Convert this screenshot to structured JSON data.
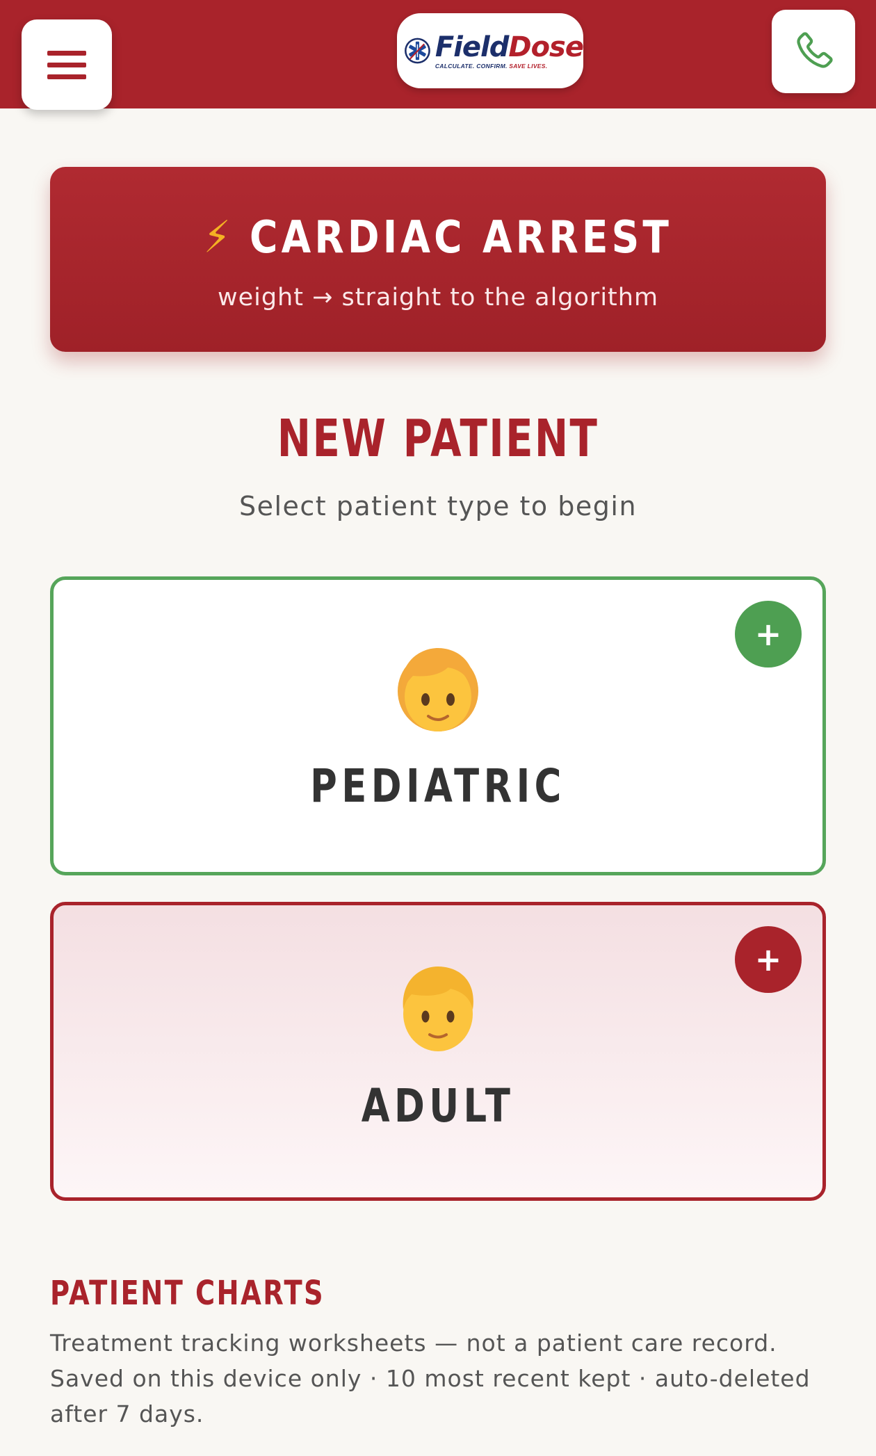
{
  "header": {
    "menu_icon": "hamburger-menu-icon",
    "phone_icon": "phone-icon",
    "logo": {
      "name_part1": "Field",
      "name_part2": "Dose",
      "tagline_part1": "CALCULATE. CONFIRM.",
      "tagline_part2": "SAVE LIVES."
    },
    "colors": {
      "bar": "#a9232b",
      "phone": "#4e9f52"
    }
  },
  "cardiac": {
    "icon": "lightning-bolt-icon",
    "title": "CARDIAC ARREST",
    "subtitle": "weight → straight to the algorithm"
  },
  "new_patient": {
    "title": "NEW PATIENT",
    "subtitle": "Select patient type to begin"
  },
  "cards": {
    "pediatric": {
      "label": "PEDIATRIC",
      "add_icon": "+",
      "accent": "#56a55a"
    },
    "adult": {
      "label": "ADULT",
      "add_icon": "+",
      "accent": "#a9232b"
    }
  },
  "patient_charts": {
    "title": "PATIENT CHARTS",
    "line1": "Treatment tracking worksheets — not a patient care record.",
    "line2": "Saved on this device only · 10 most recent kept · auto-deleted",
    "line3": "after 7 days."
  }
}
